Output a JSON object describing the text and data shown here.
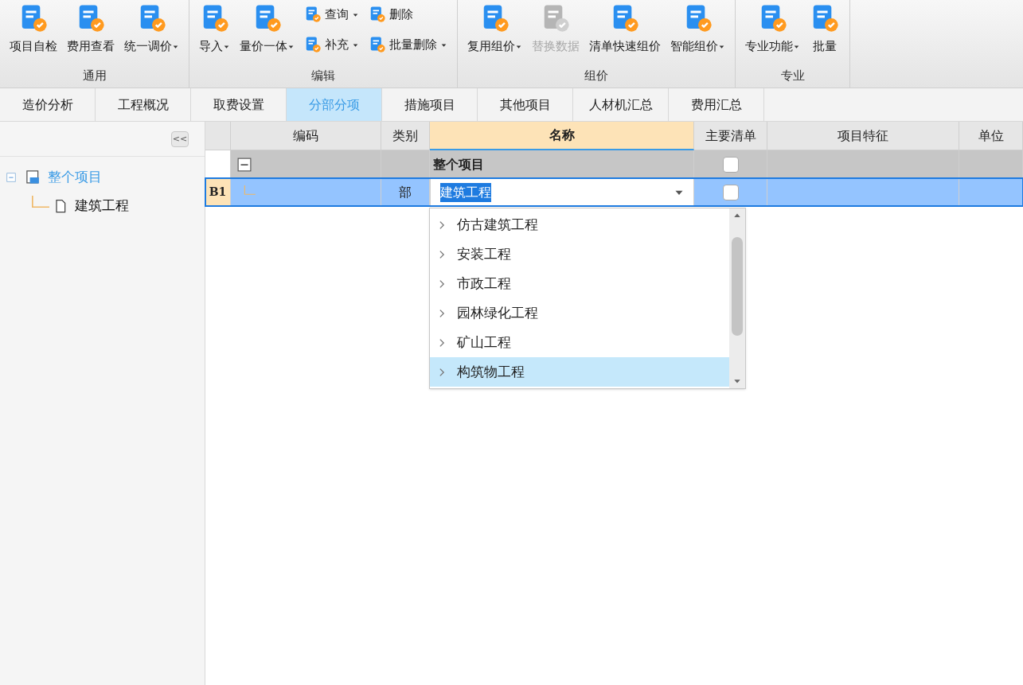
{
  "ribbon": {
    "groups": [
      {
        "label": "通用",
        "buttons": [
          {
            "kind": "large",
            "label": "项目自检",
            "dropdown": false,
            "disabled": false
          },
          {
            "kind": "large",
            "label": "费用查看",
            "dropdown": false,
            "disabled": false
          },
          {
            "kind": "large",
            "label": "统一调价",
            "dropdown": true,
            "disabled": false
          }
        ]
      },
      {
        "label": "编辑",
        "buttons": [
          {
            "kind": "large",
            "label": "导入",
            "dropdown": true,
            "disabled": false
          },
          {
            "kind": "large",
            "label": "量价一体",
            "dropdown": true,
            "disabled": false
          },
          {
            "kind": "small",
            "label": "查询",
            "dropdown": true,
            "disabled": false
          },
          {
            "kind": "small",
            "label": "补充",
            "dropdown": true,
            "disabled": false
          },
          {
            "kind": "small",
            "label": "删除",
            "dropdown": false,
            "disabled": false
          },
          {
            "kind": "small",
            "label": "批量删除",
            "dropdown": true,
            "disabled": false
          }
        ]
      },
      {
        "label": "组价",
        "buttons": [
          {
            "kind": "large",
            "label": "复用组价",
            "dropdown": true,
            "disabled": false
          },
          {
            "kind": "large",
            "label": "替换数据",
            "dropdown": false,
            "disabled": true
          },
          {
            "kind": "large",
            "label": "清单快速组价",
            "dropdown": false,
            "disabled": false
          },
          {
            "kind": "large",
            "label": "智能组价",
            "dropdown": true,
            "disabled": false
          }
        ]
      },
      {
        "label": "专业",
        "buttons": [
          {
            "kind": "large",
            "label": "专业功能",
            "dropdown": true,
            "disabled": false
          },
          {
            "kind": "large",
            "label": "批量",
            "dropdown": false,
            "disabled": false
          }
        ]
      }
    ]
  },
  "tabs": [
    {
      "label": "造价分析",
      "selected": false
    },
    {
      "label": "工程概况",
      "selected": false
    },
    {
      "label": "取费设置",
      "selected": false
    },
    {
      "label": "分部分项",
      "selected": true
    },
    {
      "label": "措施项目",
      "selected": false
    },
    {
      "label": "其他项目",
      "selected": false
    },
    {
      "label": "人材机汇总",
      "selected": false
    },
    {
      "label": "费用汇总",
      "selected": false
    }
  ],
  "sidebar": {
    "collapse_button": "<<",
    "tree": [
      {
        "label": "整个项目",
        "selected": true,
        "expanded": true,
        "children": [
          {
            "label": "建筑工程",
            "selected": false
          }
        ]
      }
    ]
  },
  "table": {
    "columns": [
      {
        "label": "编码",
        "selected": false
      },
      {
        "label": "类别",
        "selected": false
      },
      {
        "label": "名称",
        "selected": true
      },
      {
        "label": "主要清单",
        "selected": false
      },
      {
        "label": "项目特征",
        "selected": false
      },
      {
        "label": "单位",
        "selected": false
      }
    ],
    "rows": [
      {
        "kind": "group",
        "row_header": "",
        "type": "",
        "name": "整个项目",
        "main_list": false,
        "selected": false
      },
      {
        "kind": "item",
        "row_header": "B1",
        "type": "部",
        "name": "建筑工程",
        "main_list": false,
        "selected": true
      }
    ]
  },
  "dropdown": {
    "items": [
      {
        "label": "仿古建筑工程",
        "selected": false
      },
      {
        "label": "安装工程",
        "selected": false
      },
      {
        "label": "市政工程",
        "selected": false
      },
      {
        "label": "园林绿化工程",
        "selected": false
      },
      {
        "label": "矿山工程",
        "selected": false
      },
      {
        "label": "构筑物工程",
        "selected": true
      }
    ]
  }
}
